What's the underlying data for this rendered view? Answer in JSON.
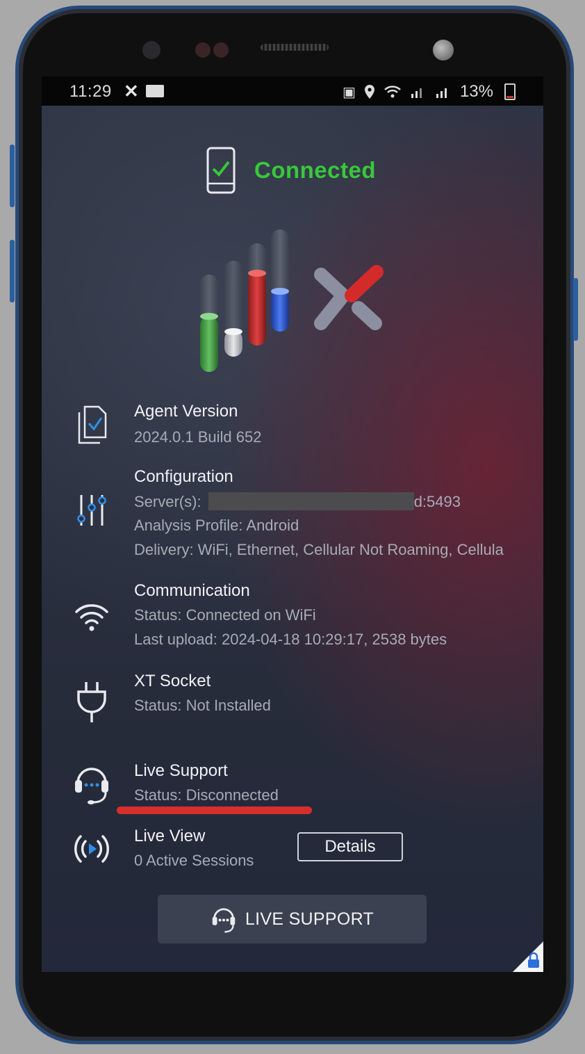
{
  "status_bar": {
    "time": "11:29",
    "battery": "13%"
  },
  "header": {
    "status": "Connected"
  },
  "items": [
    {
      "title": "Agent Version",
      "lines": [
        "2024.0.1 Build 652"
      ]
    },
    {
      "title": "Configuration",
      "server_prefix": "Server(s): ",
      "server_suffix": "d:5493",
      "analysis_profile": "Analysis Profile: Android",
      "delivery": "Delivery: WiFi, Ethernet, Cellular Not Roaming, Cellula"
    },
    {
      "title": "Communication",
      "lines": [
        "Status: Connected on WiFi",
        "Last upload: 2024-04-18 10:29:17, 2538 bytes"
      ]
    },
    {
      "title": "XT Socket",
      "lines": [
        "Status: Not Installed"
      ]
    },
    {
      "title": "Live Support",
      "lines": [
        "Status: Disconnected"
      ]
    },
    {
      "title": "Live View",
      "lines": [
        "0 Active Sessions"
      ]
    }
  ],
  "buttons": {
    "details": "Details",
    "live_support": "LIVE SUPPORT"
  },
  "colors": {
    "connected": "#38c83a",
    "accent_blue": "#2f8fe8",
    "highlight_red": "#d62f2b"
  }
}
